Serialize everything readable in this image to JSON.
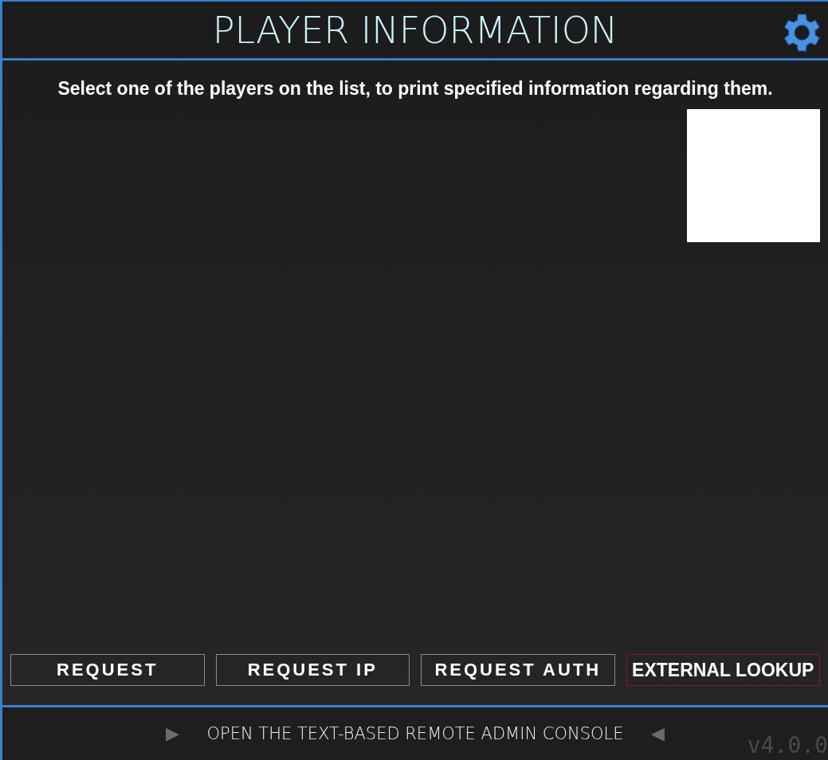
{
  "header": {
    "title": "PLAYER INFORMATION"
  },
  "instructions": "Select one of the players on the list, to print specified information regarding them.",
  "buttons": [
    {
      "label": "REQUEST",
      "kind": "plain"
    },
    {
      "label": "REQUEST IP",
      "kind": "plain"
    },
    {
      "label": "REQUEST AUTH",
      "kind": "plain"
    },
    {
      "label": "EXTERNAL LOOKUP",
      "kind": "external"
    }
  ],
  "footer": {
    "left_arrow": "▶",
    "console_link": "OPEN THE TEXT-BASED REMOTE ADMIN CONSOLE",
    "right_arrow": "◀",
    "version": "v4.0.0"
  }
}
